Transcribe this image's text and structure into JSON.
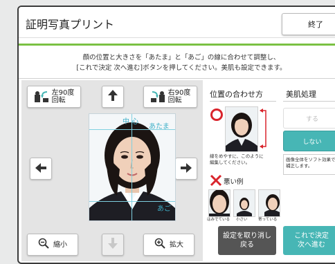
{
  "window": {
    "title": "証明写真プリント",
    "end_label": "終了"
  },
  "instructions": {
    "line1": "顔の位置と大きさを「あたま」と「あご」の線に合わせて調整し、",
    "line2": "[これで決定 次へ進む]ボタンを押してください。美肌も設定できます。"
  },
  "controls": {
    "rotate_left_line1": "左90度",
    "rotate_left_line2": "回転",
    "rotate_right_line1": "右90度",
    "rotate_right_line2": "回転",
    "shrink_label": "縮小",
    "enlarge_label": "拡大"
  },
  "photo_guides": {
    "center": "中 心",
    "head": "あたま",
    "chin": "あご"
  },
  "position_help": {
    "title": "位置の合わせ方",
    "good_caption": "線をめやすに、このように\n編集してください。",
    "bad_title": "悪い例",
    "bad_examples": [
      {
        "caption": "はみでている"
      },
      {
        "caption": "小さい"
      },
      {
        "caption": "寄っている"
      }
    ]
  },
  "skin": {
    "title": "美肌処理",
    "on_label": "する",
    "off_label": "しない",
    "description": "画像全体をソフト効果で\n補正します。"
  },
  "footer": {
    "cancel_line1": "設定を取り消し",
    "cancel_line2": "戻る",
    "next_line1": "これで決定",
    "next_line2": "次へ進む"
  },
  "colors": {
    "accent_green": "#7ac143",
    "teal": "#47b6b5",
    "dark_button": "#555555",
    "guide_cyan": "#3fb0c8",
    "error_red": "#d9242c"
  }
}
